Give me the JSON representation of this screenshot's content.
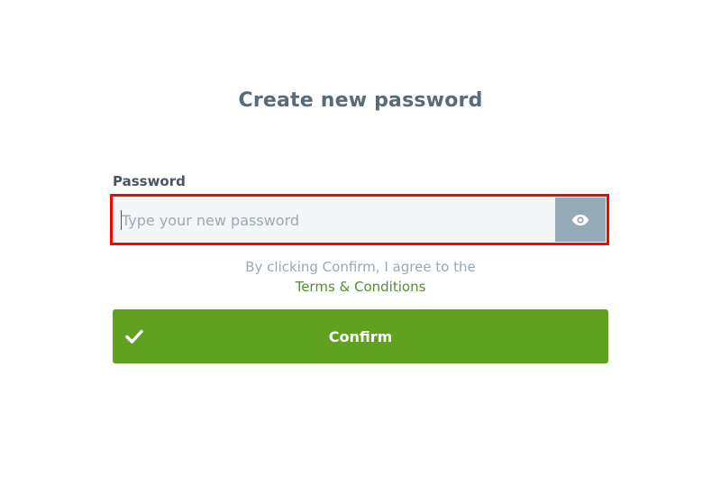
{
  "page": {
    "title": "Create new password"
  },
  "password_field": {
    "label": "Password",
    "value": "",
    "placeholder": "Type your new password"
  },
  "agreement": {
    "text": "By clicking Confirm, I agree to the",
    "terms_link": "Terms & Conditions"
  },
  "confirm_button": {
    "label": "Confirm"
  },
  "icons": {
    "toggle_visibility": "eye-icon",
    "confirm": "checkmark-icon"
  },
  "colors": {
    "title": "#5a6b78",
    "accent_green": "#61a120",
    "terms_link": "#5a8a2e",
    "eye_button": "#95aab8",
    "focus_outline": "#ff0000"
  }
}
